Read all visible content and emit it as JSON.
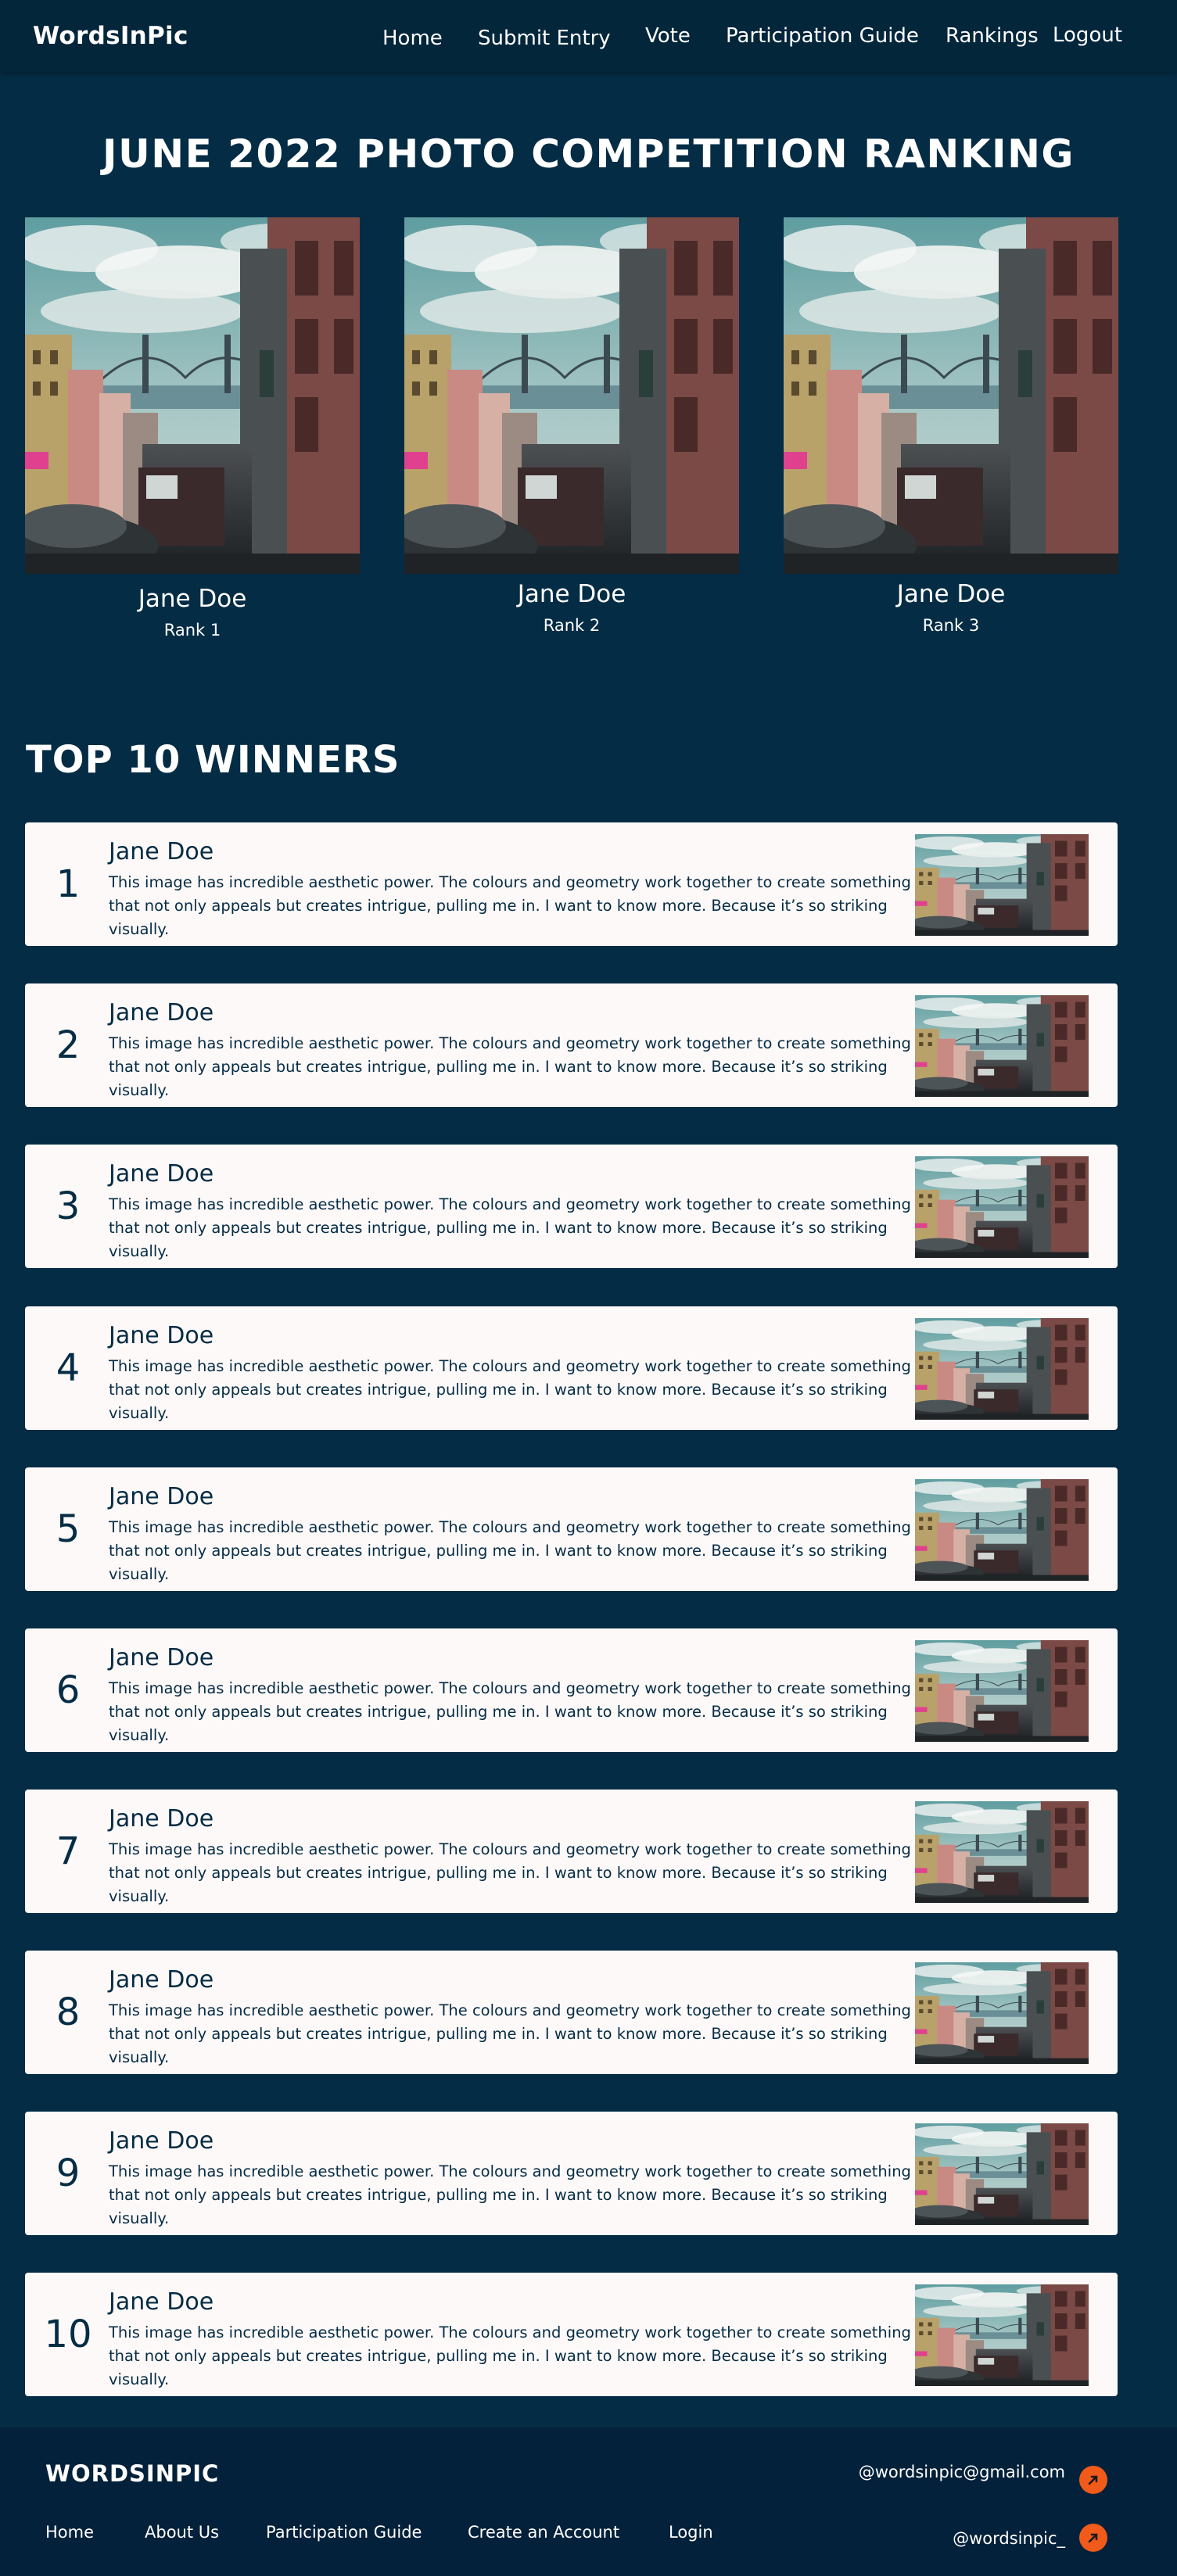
{
  "nav": {
    "brand": "WordsInPic",
    "links": [
      "Home",
      "Submit Entry",
      "Vote",
      "Participation Guide",
      "Rankings",
      "Logout"
    ]
  },
  "page_title": "JUNE 2022 PHOTO COMPETITION RANKING",
  "podium": [
    {
      "name": "Jane Doe",
      "rank": "Rank 1"
    },
    {
      "name": "Jane Doe",
      "rank": "Rank 2"
    },
    {
      "name": "Jane Doe",
      "rank": "Rank 3"
    }
  ],
  "top_title": "TOP 10 WINNERS",
  "winners": [
    {
      "number": "1",
      "name": "Jane Doe",
      "text": "This image has incredible aesthetic power. The colours and geometry work together to create something that not only appeals but creates intrigue, pulling me in. I want to know more. Because it’s so striking visually."
    },
    {
      "number": "2",
      "name": "Jane Doe",
      "text": "This image has incredible aesthetic power. The colours and geometry work together to create something that not only appeals but creates intrigue, pulling me in. I want to know more. Because it’s so striking visually."
    },
    {
      "number": "3",
      "name": "Jane Doe",
      "text": "This image has incredible aesthetic power. The colours and geometry work together to create something that not only appeals but creates intrigue, pulling me in. I want to know more. Because it’s so striking visually."
    },
    {
      "number": "4",
      "name": "Jane Doe",
      "text": "This image has incredible aesthetic power. The colours and geometry work together to create something that not only appeals but creates intrigue, pulling me in. I want to know more. Because it’s so striking visually."
    },
    {
      "number": "5",
      "name": "Jane Doe",
      "text": "This image has incredible aesthetic power. The colours and geometry work together to create something that not only appeals but creates intrigue, pulling me in. I want to know more. Because it’s so striking visually."
    },
    {
      "number": "6",
      "name": "Jane Doe",
      "text": "This image has incredible aesthetic power. The colours and geometry work together to create something that not only appeals but creates intrigue, pulling me in. I want to know more. Because it’s so striking visually."
    },
    {
      "number": "7",
      "name": "Jane Doe",
      "text": "This image has incredible aesthetic power. The colours and geometry work together to create something that not only appeals but creates intrigue, pulling me in. I want to know more. Because it’s so striking visually."
    },
    {
      "number": "8",
      "name": "Jane Doe",
      "text": "This image has incredible aesthetic power. The colours and geometry work together to create something that not only appeals but creates intrigue, pulling me in. I want to know more. Because it’s so striking visually."
    },
    {
      "number": "9",
      "name": "Jane Doe",
      "text": "This image has incredible aesthetic power. The colours and geometry work together to create something that not only appeals but creates intrigue, pulling me in. I want to know more. Because it’s so striking visually."
    },
    {
      "number": "10",
      "name": "Jane Doe",
      "text": "This image has incredible aesthetic power. The colours and geometry work together to create something that not only appeals but creates intrigue, pulling me in. I want to know more. Because it’s so striking visually."
    }
  ],
  "footer": {
    "brand": "WORDSINPIC",
    "links": [
      "Home",
      "About Us",
      "Participation Guide",
      "Create an Account",
      "Login"
    ],
    "email": "@wordsinpic@gmail.com",
    "handle": "@wordsinpic_",
    "icons": [
      "arrow-icon",
      "arrow-icon"
    ]
  },
  "colors": {
    "page_bg": "#052c45",
    "nav_bg": "#03263b",
    "footer_bg": "#03213a",
    "card_bg": "#fdf9f8",
    "accent": "#f05a1a"
  }
}
